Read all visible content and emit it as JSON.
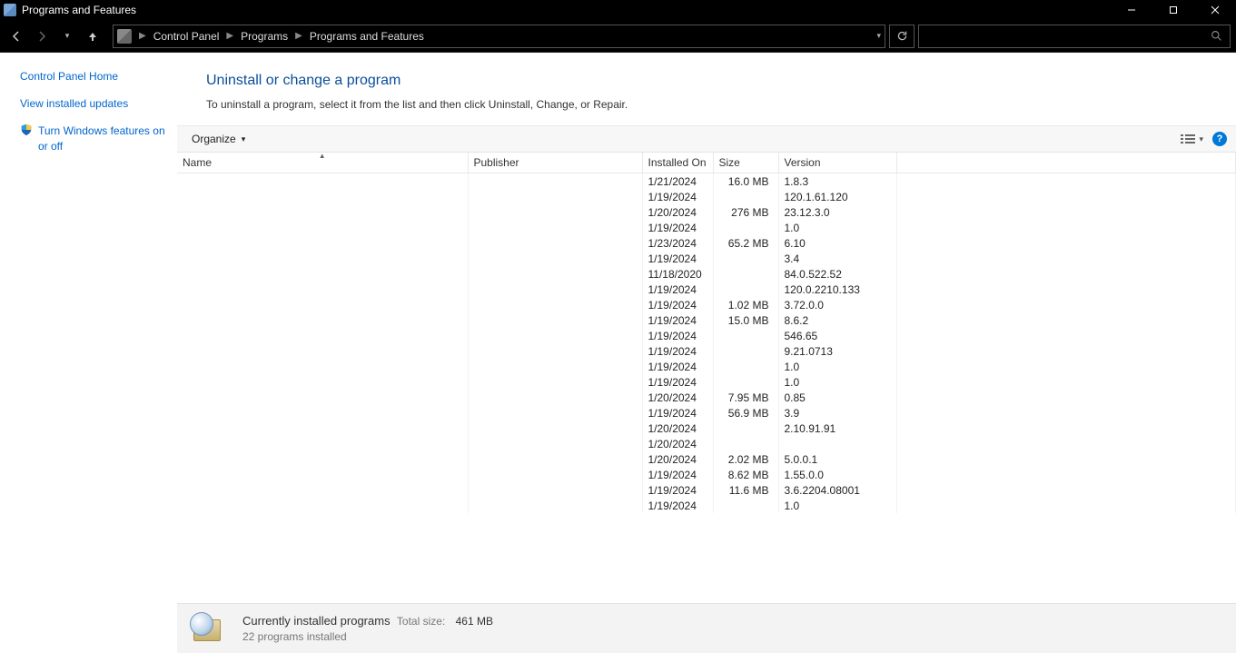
{
  "window": {
    "title": "Programs and Features"
  },
  "breadcrumb": {
    "items": [
      "Control Panel",
      "Programs",
      "Programs and Features"
    ]
  },
  "sidebar": {
    "home": "Control Panel Home",
    "updates": "View installed updates",
    "features": "Turn Windows features on or off"
  },
  "main": {
    "heading": "Uninstall or change a program",
    "subtext": "To uninstall a program, select it from the list and then click Uninstall, Change, or Repair."
  },
  "toolbar": {
    "organize": "Organize"
  },
  "columns": {
    "name": "Name",
    "publisher": "Publisher",
    "installed": "Installed On",
    "size": "Size",
    "version": "Version"
  },
  "rows": [
    {
      "name": "",
      "publisher": "",
      "installed": "1/21/2024",
      "size": "16.0 MB",
      "version": "1.8.3"
    },
    {
      "name": "",
      "publisher": "",
      "installed": "1/19/2024",
      "size": "",
      "version": "120.1.61.120"
    },
    {
      "name": "",
      "publisher": "",
      "installed": "1/20/2024",
      "size": "276 MB",
      "version": "23.12.3.0"
    },
    {
      "name": "",
      "publisher": "",
      "installed": "1/19/2024",
      "size": "",
      "version": "1.0"
    },
    {
      "name": "",
      "publisher": "",
      "installed": "1/23/2024",
      "size": "65.2 MB",
      "version": "6.10"
    },
    {
      "name": "",
      "publisher": "",
      "installed": "1/19/2024",
      "size": "",
      "version": "3.4"
    },
    {
      "name": "",
      "publisher": "",
      "installed": "11/18/2020",
      "size": "",
      "version": "84.0.522.52"
    },
    {
      "name": "",
      "publisher": "",
      "installed": "1/19/2024",
      "size": "",
      "version": "120.0.2210.133"
    },
    {
      "name": "",
      "publisher": "",
      "installed": "1/19/2024",
      "size": "1.02 MB",
      "version": "3.72.0.0"
    },
    {
      "name": "",
      "publisher": "",
      "installed": "1/19/2024",
      "size": "15.0 MB",
      "version": "8.6.2"
    },
    {
      "name": "",
      "publisher": "",
      "installed": "1/19/2024",
      "size": "",
      "version": "546.65"
    },
    {
      "name": "",
      "publisher": "",
      "installed": "1/19/2024",
      "size": "",
      "version": "9.21.0713"
    },
    {
      "name": "",
      "publisher": "",
      "installed": "1/19/2024",
      "size": "",
      "version": "1.0"
    },
    {
      "name": "",
      "publisher": "",
      "installed": "1/19/2024",
      "size": "",
      "version": "1.0"
    },
    {
      "name": "",
      "publisher": "",
      "installed": "1/20/2024",
      "size": "7.95 MB",
      "version": "0.85"
    },
    {
      "name": "",
      "publisher": "",
      "installed": "1/19/2024",
      "size": "56.9 MB",
      "version": "3.9"
    },
    {
      "name": "",
      "publisher": "",
      "installed": "1/20/2024",
      "size": "",
      "version": "2.10.91.91"
    },
    {
      "name": "",
      "publisher": "",
      "installed": "1/20/2024",
      "size": "",
      "version": ""
    },
    {
      "name": "",
      "publisher": "",
      "installed": "1/20/2024",
      "size": "2.02 MB",
      "version": "5.0.0.1"
    },
    {
      "name": "",
      "publisher": "",
      "installed": "1/19/2024",
      "size": "8.62 MB",
      "version": "1.55.0.0"
    },
    {
      "name": "",
      "publisher": "",
      "installed": "1/19/2024",
      "size": "11.6 MB",
      "version": "3.6.2204.08001"
    },
    {
      "name": "",
      "publisher": "",
      "installed": "1/19/2024",
      "size": "",
      "version": "1.0"
    }
  ],
  "status": {
    "title": "Currently installed programs",
    "size_label": "Total size:",
    "size_value": "461 MB",
    "count": "22 programs installed"
  }
}
